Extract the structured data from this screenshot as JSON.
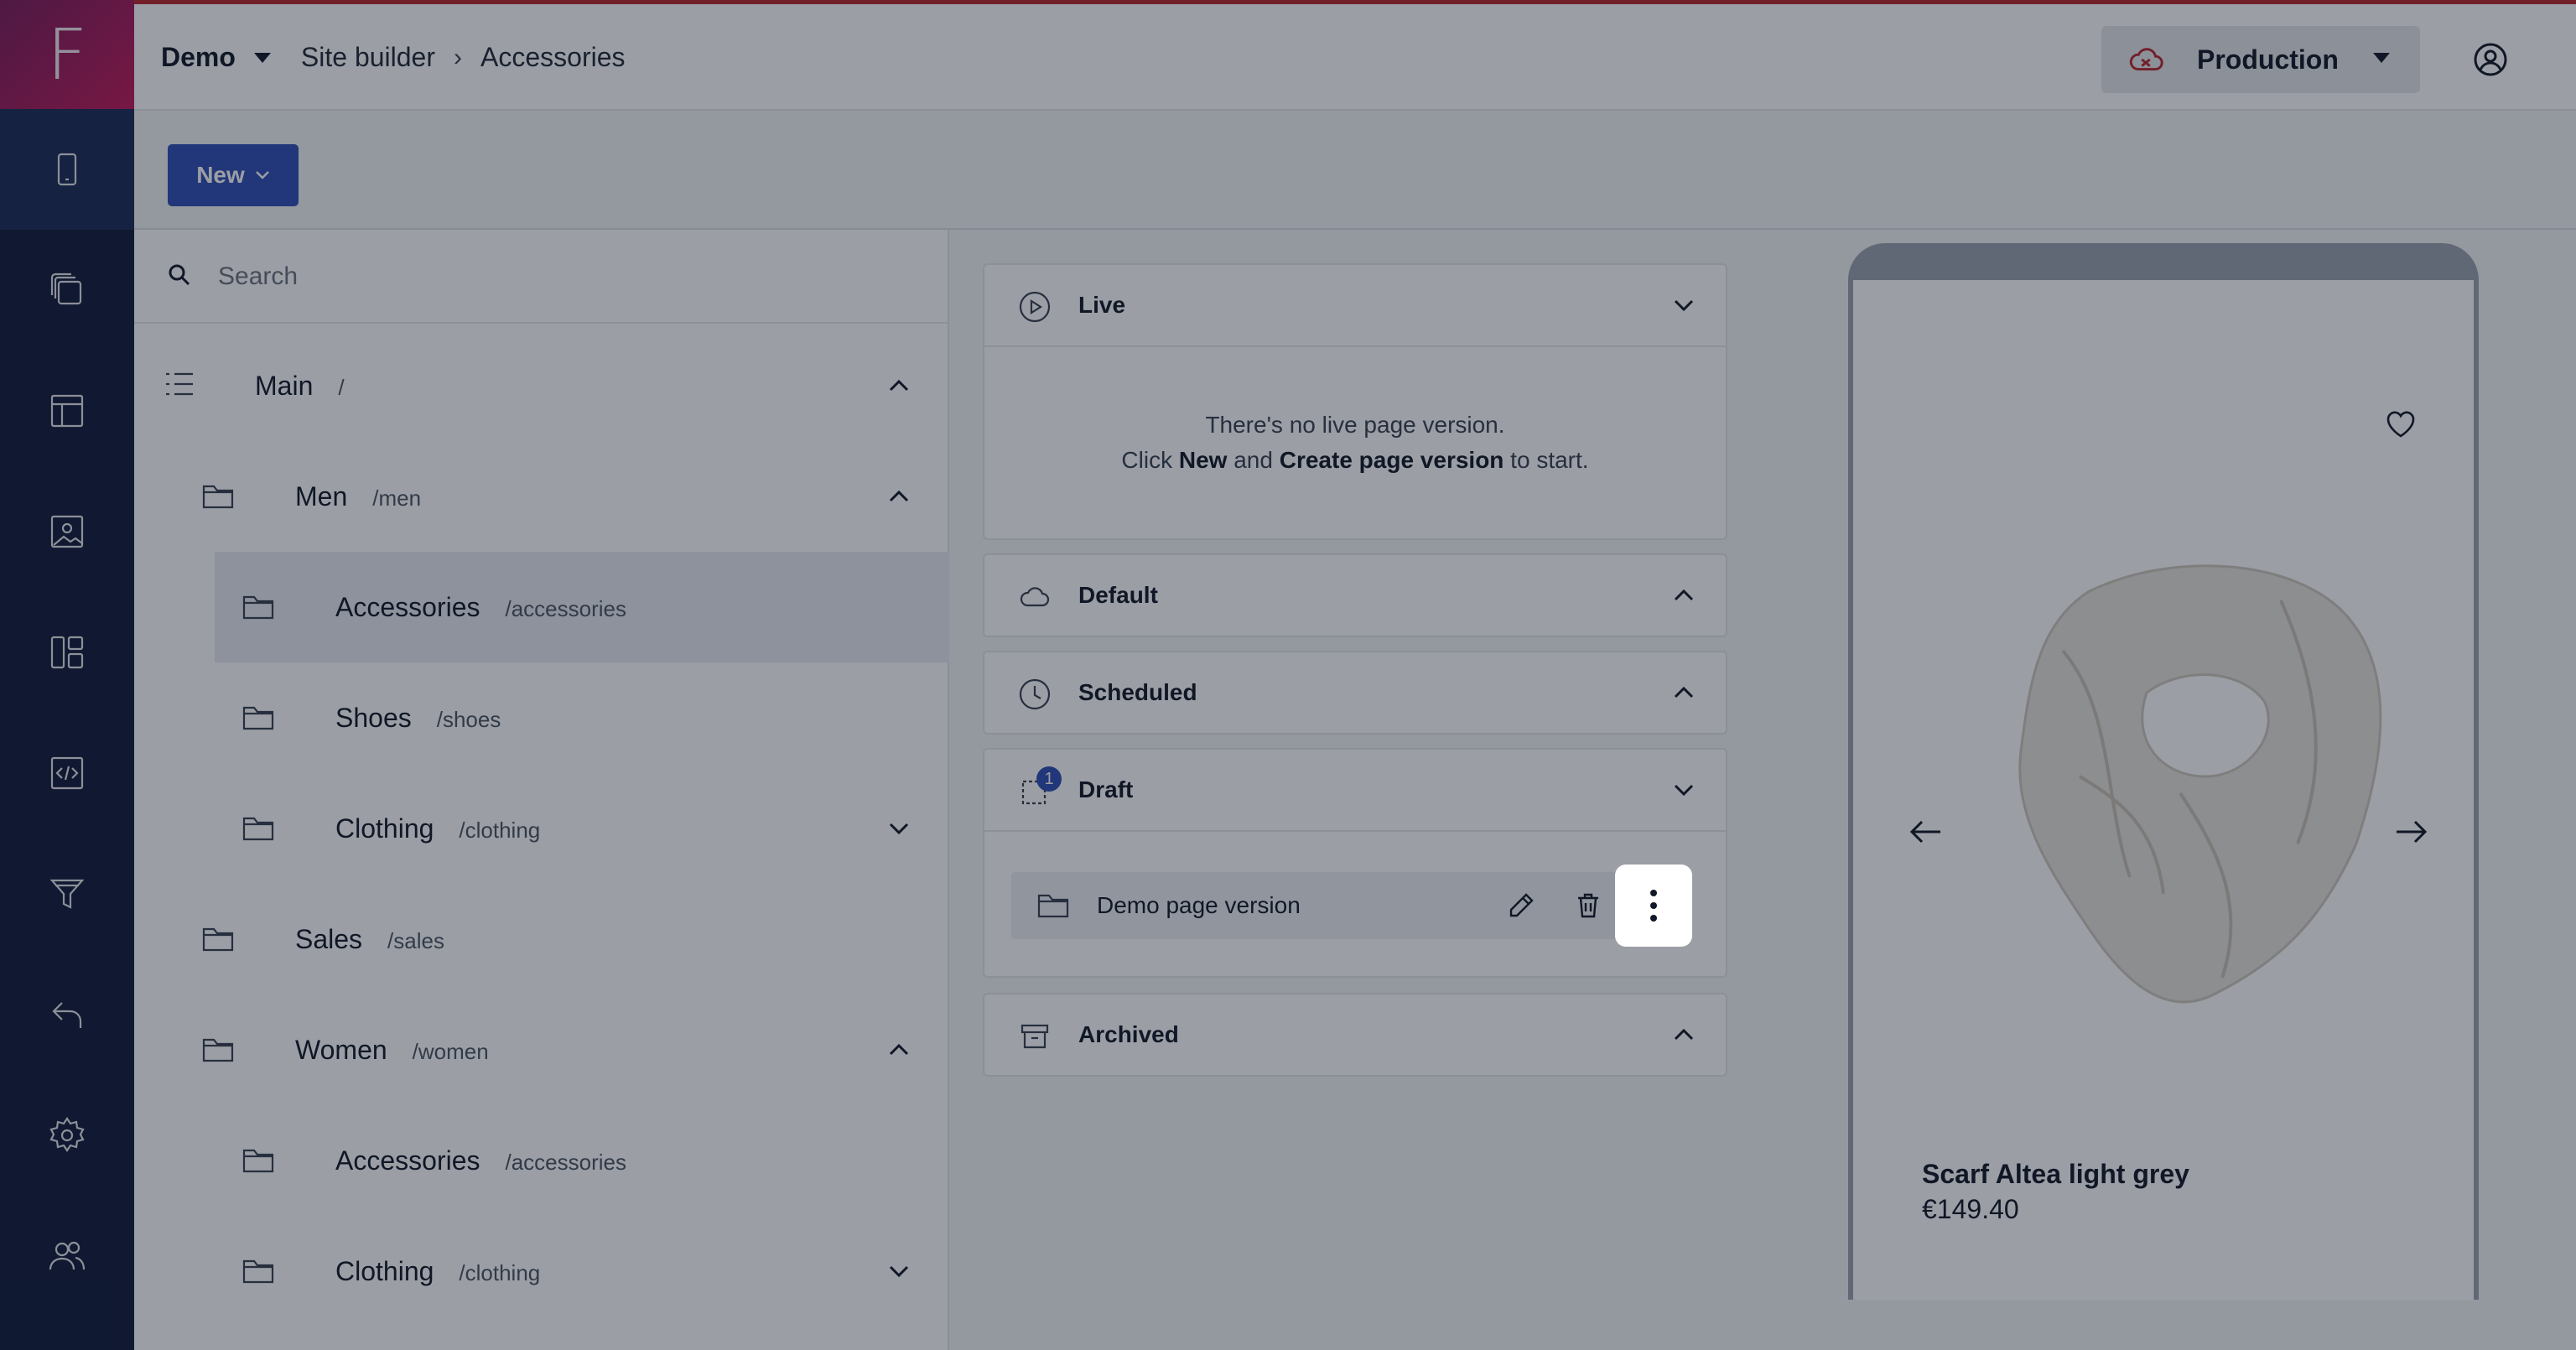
{
  "brand": {
    "letter": "F"
  },
  "rail": {
    "items": [
      {
        "icon": "mobile-icon"
      },
      {
        "icon": "pages-icon"
      },
      {
        "icon": "layout-icon"
      },
      {
        "icon": "image-icon"
      },
      {
        "icon": "dashboard-icon"
      },
      {
        "icon": "code-icon"
      },
      {
        "icon": "filter-icon"
      },
      {
        "icon": "undo-icon"
      },
      {
        "icon": "gear-icon"
      },
      {
        "icon": "users-icon"
      }
    ]
  },
  "header": {
    "project": "Demo",
    "breadcrumb": [
      "Site builder",
      "Accessories"
    ],
    "environment": "Production",
    "accent_color": "#b8252d"
  },
  "toolbar": {
    "new_label": "New"
  },
  "search": {
    "placeholder": "Search"
  },
  "tree": [
    {
      "name": "Main",
      "path": "/",
      "expanded": true
    },
    {
      "name": "Men",
      "path": "/men",
      "expanded": true
    },
    {
      "name": "Accessories",
      "path": "/accessories",
      "selected": true
    },
    {
      "name": "Shoes",
      "path": "/shoes"
    },
    {
      "name": "Clothing",
      "path": "/clothing",
      "expanded": false
    },
    {
      "name": "Sales",
      "path": "/sales"
    },
    {
      "name": "Women",
      "path": "/women",
      "expanded": true
    },
    {
      "name": "Accessories",
      "path": "/accessories"
    },
    {
      "name": "Clothing",
      "path": "/clothing",
      "expanded": false
    }
  ],
  "versions": {
    "live": {
      "title": "Live",
      "empty_line1": "There's no live page version.",
      "empty_pre": "Click ",
      "empty_new": "New",
      "empty_mid": " and ",
      "empty_create": "Create page version",
      "empty_post": " to start."
    },
    "default": {
      "title": "Default"
    },
    "scheduled": {
      "title": "Scheduled"
    },
    "draft": {
      "title": "Draft",
      "count": "1",
      "item": "Demo page version"
    },
    "archived": {
      "title": "Archived"
    }
  },
  "preview": {
    "product_name": "Scarf Altea light grey",
    "price": "€149.40"
  }
}
